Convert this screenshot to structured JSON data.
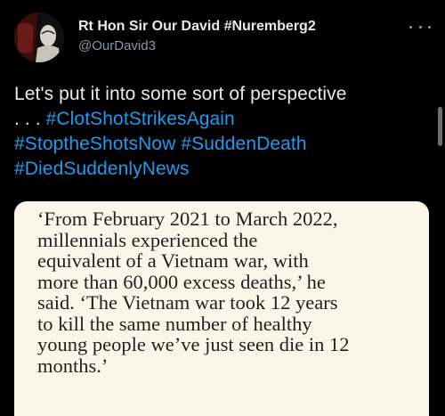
{
  "author": {
    "display_name": "Rt Hon Sir Our David #Nuremberg2",
    "handle": "@OurDavid3"
  },
  "icons": {
    "more": "more-horizontal-icon"
  },
  "tweet": {
    "text_intro": "Let's put it into some sort of perspective",
    "text_ellipsis": ". . .",
    "hashtags": [
      "#ClotShotStrikesAgain",
      "#StoptheShotsNow",
      "#SuddenDeath",
      "#DiedSuddenlyNews"
    ]
  },
  "image": {
    "quote_lines": [
      "‘From February 2021 to March 2022,",
      "millennials experienced the",
      "equivalent of a Vietnam war, with",
      "more than 60,000 excess deaths,’ he",
      "said. ‘The Vietnam war took 12 years",
      "to kill the same number of healthy",
      "young people we’ve just seen die in 12",
      "months.’"
    ]
  },
  "colors": {
    "background": "#000000",
    "text": "#e7e9ea",
    "secondary_text": "#8b98a5",
    "link": "#1d9bf0",
    "card_background": "#fbf6e8",
    "card_text": "#231f1c"
  }
}
